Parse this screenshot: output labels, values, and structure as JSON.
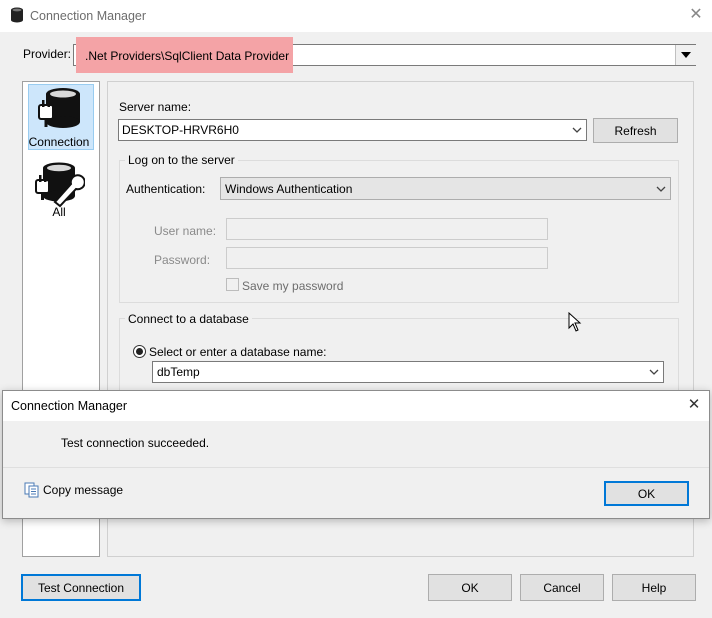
{
  "window": {
    "title": "Connection Manager",
    "close_glyph": "✕"
  },
  "provider": {
    "label": "Provider:",
    "value": ".Net Providers\\SqlClient Data Provider",
    "highlight_color": "#f4a3a6"
  },
  "nav": {
    "items": [
      {
        "label": "Connection",
        "icon": "database-plug-icon",
        "selected": true
      },
      {
        "label": "All",
        "icon": "database-wrench-icon",
        "selected": false
      }
    ]
  },
  "server": {
    "label": "Server name:",
    "value": "DESKTOP-HRVR6H0",
    "refresh_label": "Refresh"
  },
  "logon": {
    "legend": "Log on to the server",
    "auth_label": "Authentication:",
    "auth_value": "Windows Authentication",
    "user_label": "User name:",
    "user_value": "",
    "password_label": "Password:",
    "password_value": "",
    "save_password_label": "Save my password",
    "save_password_checked": false
  },
  "database": {
    "legend": "Connect to a database",
    "radio_label": "Select or enter a database name:",
    "radio_selected": true,
    "value": "dbTemp"
  },
  "buttons": {
    "test": "Test Connection",
    "ok": "OK",
    "cancel": "Cancel",
    "help": "Help"
  },
  "message_dialog": {
    "title": "Connection Manager",
    "close_glyph": "✕",
    "text": "Test connection succeeded.",
    "copy_label": "Copy message",
    "ok_label": "OK"
  },
  "colors": {
    "accent": "#0078d7",
    "selection_bg": "#cde6fb"
  }
}
